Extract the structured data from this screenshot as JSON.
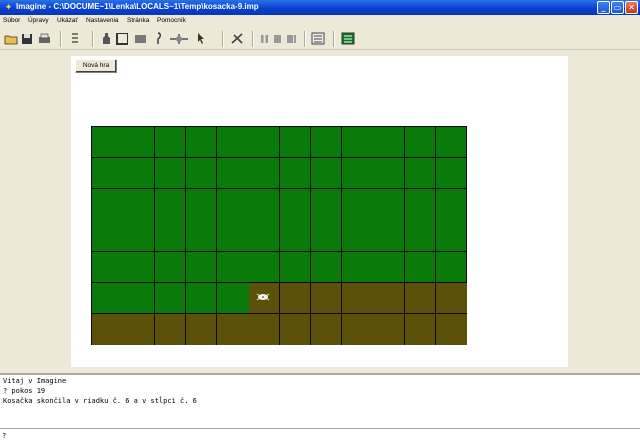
{
  "window": {
    "title": "Imagine - C:\\DOCUME~1\\Lenka\\LOCALS~1\\Temp\\kosacka-9.imp",
    "minimize": "_",
    "maximize": "▭",
    "close": "✕"
  },
  "menu": [
    "Súbor",
    "Úpravy",
    "Ukázať",
    "Nastavenia",
    "Stránka",
    "Pomocník"
  ],
  "toolbar": {
    "icons": [
      "open-folder-icon",
      "save-icon",
      "print-icon",
      "turtle-new-icon",
      "bottle-icon",
      "frame-icon",
      "rectangle-icon",
      "pen-icon",
      "move-icon",
      "pointer-icon",
      "bug-icon",
      "pause-icon",
      "stop-icon",
      "step-icon",
      "dialog-icon",
      "layout-icon"
    ]
  },
  "canvas": {
    "new_game_label": "Nová hra"
  },
  "grid": {
    "colors": {
      "grass": "#0a7a0a",
      "mowed": "#5b5109",
      "line": "#0a0a0a"
    }
  },
  "console": {
    "lines": [
      "Vitaj v Imagine",
      "? pokos 19",
      "Kosačka skončila v riadku č. 6 a v stĺpci č. 6"
    ],
    "prompt": "?"
  }
}
